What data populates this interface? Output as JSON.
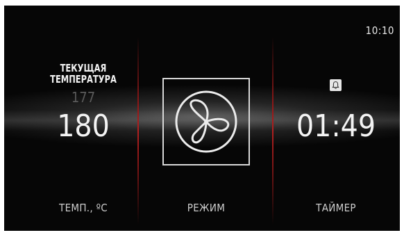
{
  "clock": "10:10",
  "temperature": {
    "title_line1": "ТЕКУЩАЯ",
    "title_line2": "ТЕМПЕРАТУРА",
    "set_value": "177",
    "current_value": "180",
    "label": "ТЕМП., ºС"
  },
  "mode": {
    "icon": "fan-icon",
    "label": "РЕЖИМ"
  },
  "timer": {
    "icon": "bell-icon",
    "value": "01:49",
    "label": "ТАЙМЕР"
  },
  "colors": {
    "background": "#060606",
    "divider": "#b42020",
    "text": "#f4f4f4"
  }
}
